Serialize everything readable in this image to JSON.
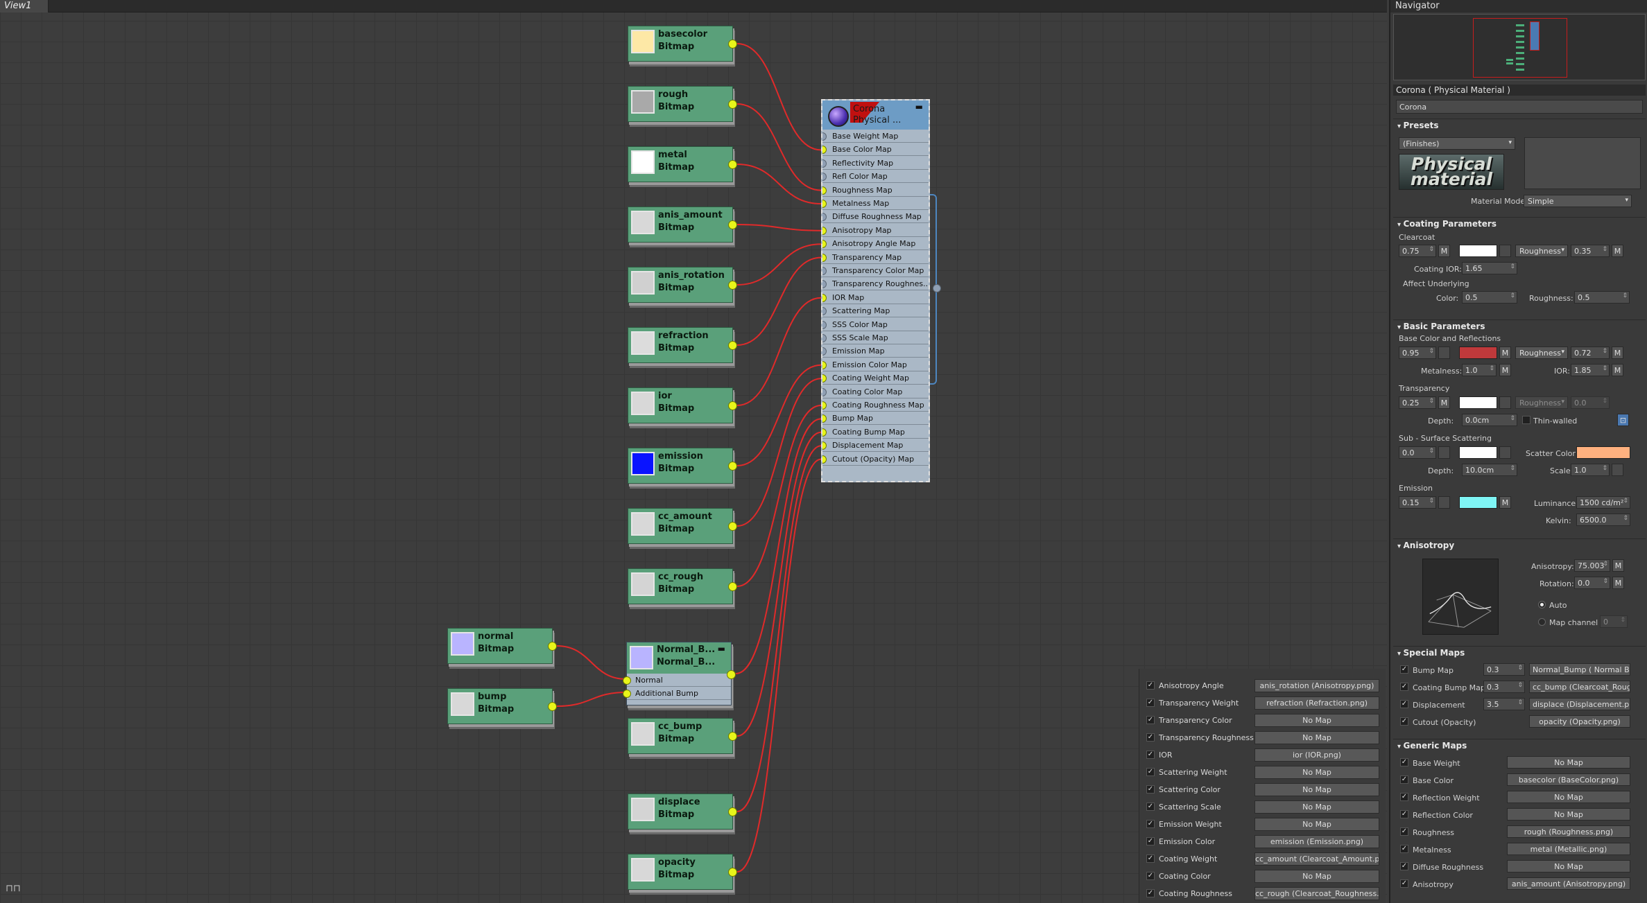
{
  "view": {
    "tab": "View1"
  },
  "bitmap_nodes": [
    {
      "name": "basecolor",
      "type": "Bitmap",
      "swatch": "#fde8a6"
    },
    {
      "name": "rough",
      "type": "Bitmap",
      "swatch": "#a9a9a9"
    },
    {
      "name": "metal",
      "type": "Bitmap",
      "swatch": "#ffffff"
    },
    {
      "name": "anis_amount",
      "type": "Bitmap",
      "swatch": "#d8d8d8"
    },
    {
      "name": "anis_rotation",
      "type": "Bitmap",
      "swatch": "#d0d0d0"
    },
    {
      "name": "refraction",
      "type": "Bitmap",
      "swatch": "#dcdcdc"
    },
    {
      "name": "ior",
      "type": "Bitmap",
      "swatch": "#d8d8d8"
    },
    {
      "name": "emission",
      "type": "Bitmap",
      "swatch": "#0a14ff"
    },
    {
      "name": "cc_amount",
      "type": "Bitmap",
      "swatch": "#d8d8d8"
    },
    {
      "name": "cc_rough",
      "type": "Bitmap",
      "swatch": "#d4d4d4"
    },
    {
      "name": "normal",
      "type": "Bitmap",
      "swatch": "#b9b4ff"
    },
    {
      "name": "bump",
      "type": "Bitmap",
      "swatch": "#d8d8d8"
    },
    {
      "name": "cc_bump",
      "type": "Bitmap",
      "swatch": "#d8d8d8"
    },
    {
      "name": "displace",
      "type": "Bitmap",
      "swatch": "#d4d4d4"
    },
    {
      "name": "opacity",
      "type": "Bitmap",
      "swatch": "#d8d8d8"
    }
  ],
  "material_node": {
    "title1": "Corona",
    "title2": "Physical ...",
    "slots": [
      "Base Weight Map",
      "Base Color Map",
      "Reflectivity Map",
      "Refl Color Map",
      "Roughness Map",
      "Metalness Map",
      "Diffuse Roughness Map",
      "Anisotropy Map",
      "Anisotropy Angle Map",
      "Transparency Map",
      "Transparency Color Map",
      "Transparency Roughnes...",
      "IOR Map",
      "Scattering Map",
      "SSS Color Map",
      "SSS Scale Map",
      "Emission Map",
      "Emission Color Map",
      "Coating Weight Map",
      "Coating Color Map",
      "Coating Roughness Map",
      "Bump Map",
      "Coating Bump Map",
      "Displacement Map",
      "Cutout (Opacity) Map"
    ],
    "connected": [
      1,
      4,
      5,
      7,
      8,
      9,
      12,
      17,
      18,
      20,
      21,
      22,
      23,
      24
    ]
  },
  "bump_node": {
    "title1": "Normal_B...",
    "title2": "Normal_B...",
    "inputs": [
      "Normal",
      "Additional Bump"
    ]
  },
  "param_table": [
    {
      "label": "Anisotropy Angle",
      "map": "anis_rotation (Anisotropy.png)"
    },
    {
      "label": "Transparency Weight",
      "map": "refraction (Refraction.png)"
    },
    {
      "label": "Transparency Color",
      "map": "No Map"
    },
    {
      "label": "Transparency Roughness",
      "map": "No Map"
    },
    {
      "label": "IOR",
      "map": "ior (IOR.png)"
    },
    {
      "label": "Scattering Weight",
      "map": "No Map"
    },
    {
      "label": "Scattering Color",
      "map": "No Map"
    },
    {
      "label": "Scattering Scale",
      "map": "No Map"
    },
    {
      "label": "Emission Weight",
      "map": "No Map"
    },
    {
      "label": "Emission Color",
      "map": "emission (Emission.png)"
    },
    {
      "label": "Coating Weight",
      "map": "cc_amount (Clearcoat_Amount.png)"
    },
    {
      "label": "Coating Color",
      "map": "No Map"
    },
    {
      "label": "Coating Roughness",
      "map": "cc_rough (Clearcoat_Roughness..."
    }
  ],
  "navigator": {
    "title": "Navigator"
  },
  "panel": {
    "title": "Corona  ( Physical Material )",
    "name": "Corona",
    "presets": {
      "header": "Presets",
      "dropdown": "(Finishes)",
      "logo": "Physical material",
      "mode_label": "Material Mode:",
      "mode": "Simple"
    },
    "coating": {
      "header": "Coating Parameters",
      "clearcoat": "Clearcoat",
      "amount": "0.75",
      "m": "M",
      "rough_mode": "Roughness",
      "rough": "0.35",
      "ior_label": "Coating IOR:",
      "ior": "1.65",
      "affect": "Affect Underlying",
      "color_label": "Color:",
      "color": "0.5",
      "r_label": "Roughness:",
      "r": "0.5",
      "swatch": "#ffffff"
    },
    "basic": {
      "header": "Basic Parameters",
      "sub": "Base Color and Reflections",
      "level": "0.95",
      "m": "M",
      "swatch": "#c0393b",
      "rough_mode": "Roughness",
      "rough": "0.72",
      "metal_label": "Metalness:",
      "metal": "1.0",
      "ior_label": "IOR:",
      "ior": "1.85"
    },
    "transparency": {
      "label": "Transparency",
      "level": "0.25",
      "m": "M",
      "swatch": "#ffffff",
      "rough_mode": "Roughness",
      "rough": "0.0",
      "depth_label": "Depth:",
      "depth": "0.0cm",
      "thin": "Thin-walled"
    },
    "sss": {
      "label": "Sub - Surface Scattering",
      "level": "0.0",
      "swatch": "#ffffff",
      "scatter_label": "Scatter Color:",
      "scatter": "#ffb17f",
      "depth_label": "Depth:",
      "depth": "10.0cm",
      "scale_label": "Scale:",
      "scale": "1.0"
    },
    "emission": {
      "label": "Emission",
      "level": "0.15",
      "m": "M",
      "swatch": "#7ff5f5",
      "lum_label": "Luminance:",
      "lum": "1500 cd/m²",
      "kelvin_label": "Kelvin:",
      "kelvin": "6500.0"
    },
    "anisotropy": {
      "header": "Anisotropy",
      "amount_label": "Anisotropy:",
      "amount": "75.003",
      "rot_label": "Rotation:",
      "rot": "0.0",
      "auto": "Auto",
      "channel": "Map channel",
      "channel_val": "0",
      "m": "M"
    },
    "special": {
      "header": "Special Maps",
      "rows": [
        {
          "label": "Bump Map",
          "val": "0.3",
          "map": "Normal_Bump  ( Normal Bu..."
        },
        {
          "label": "Coating Bump Map",
          "val": "0.3",
          "map": "cc_bump (Clearcoat_Roug..."
        },
        {
          "label": "Displacement",
          "val": "3.5",
          "map": "displace (Displacement.png)"
        },
        {
          "label": "Cutout (Opacity)",
          "val": "",
          "map": "opacity (Opacity.png)"
        }
      ]
    },
    "generic": {
      "header": "Generic Maps",
      "rows": [
        {
          "label": "Base Weight",
          "map": "No Map"
        },
        {
          "label": "Base Color",
          "map": "basecolor (BaseColor.png)"
        },
        {
          "label": "Reflection Weight",
          "map": "No Map"
        },
        {
          "label": "Reflection Color",
          "map": "No Map"
        },
        {
          "label": "Roughness",
          "map": "rough (Roughness.png)"
        },
        {
          "label": "Metalness",
          "map": "metal (Metallic.png)"
        },
        {
          "label": "Diffuse Roughness",
          "map": "No Map"
        },
        {
          "label": "Anisotropy",
          "map": "anis_amount (Anisotropy.png)"
        }
      ]
    }
  }
}
